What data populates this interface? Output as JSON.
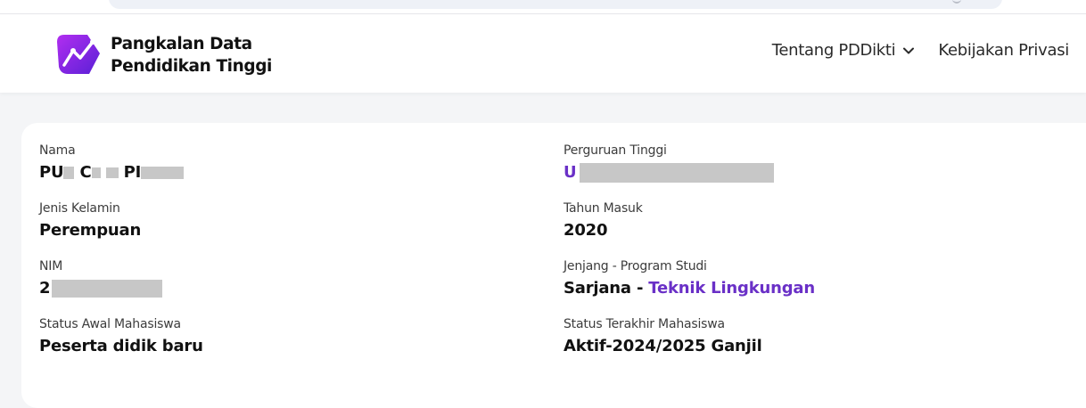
{
  "brand": {
    "line1": "Pangkalan Data",
    "line2": "Pendidikan Tinggi",
    "colors": {
      "logo_start": "#9b27e8",
      "logo_end": "#5a20d6"
    }
  },
  "nav": {
    "items": [
      {
        "label": "Tentang PDDikti",
        "has_dropdown": true,
        "icon": "chevron-down-icon"
      },
      {
        "label": "Kebijakan Privasi",
        "has_dropdown": false
      }
    ]
  },
  "student": {
    "nama": {
      "label": "Nama",
      "value_prefix": "PU",
      "value_mid1": "C",
      "value_mid2": "PI"
    },
    "jenis_kelamin": {
      "label": "Jenis Kelamin",
      "value": "Perempuan"
    },
    "nim": {
      "label": "NIM",
      "value_prefix": "2"
    },
    "status_awal": {
      "label": "Status Awal Mahasiswa",
      "value": "Peserta didik baru"
    },
    "perguruan_tinggi": {
      "label": "Perguruan Tinggi",
      "value_prefix": "U"
    },
    "tahun_masuk": {
      "label": "Tahun Masuk",
      "value": "2020"
    },
    "jenjang_prodi": {
      "label": "Jenjang - Program Studi",
      "jenjang": "Sarjana",
      "separator": " - ",
      "prodi": "Teknik Lingkungan"
    },
    "status_terakhir": {
      "label": "Status Terakhir Mahasiswa",
      "value": "Aktif-2024/2025 Ganjil"
    }
  },
  "colors": {
    "link": "#6a30c7",
    "redaction": "#c7c7c7",
    "background": "#f4f5f7"
  }
}
